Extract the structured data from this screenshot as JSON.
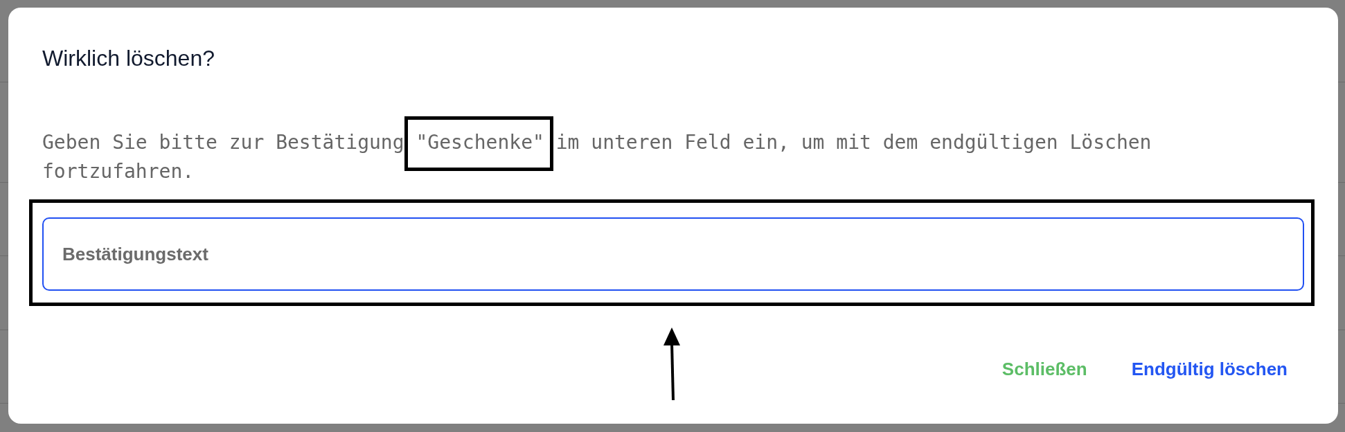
{
  "dialog": {
    "title": "Wirklich löschen?",
    "message": {
      "before": "Geben Sie bitte zur Bestätigung",
      "keyword": "\"Geschenke\"",
      "after": "im unteren Feld ein, um mit dem endgültigen Löschen fortzufahren."
    },
    "input": {
      "placeholder": "Bestätigungstext",
      "focused": true
    },
    "buttons": [
      {
        "label": "Schließen",
        "kind": "close"
      },
      {
        "label": "Endgültig löschen",
        "kind": "confirm"
      }
    ]
  },
  "annotations": {
    "keyword_frame": true,
    "input_frame": true,
    "arrow": true
  }
}
